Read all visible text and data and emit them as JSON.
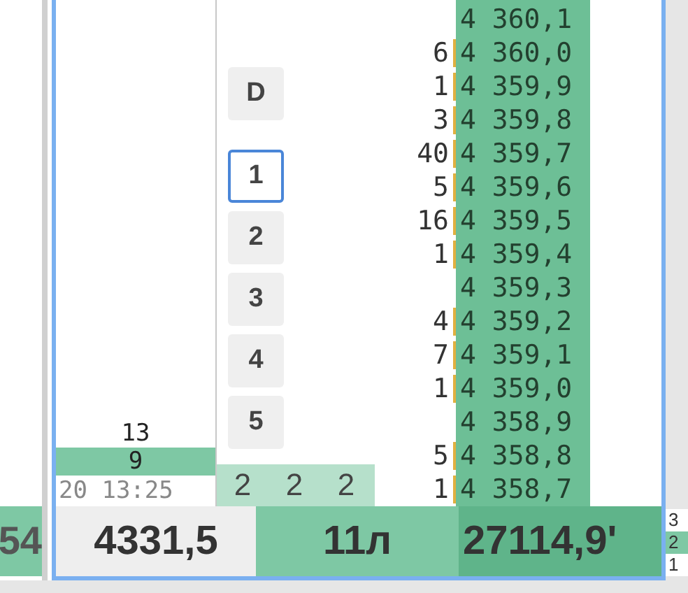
{
  "left_panel": {
    "bottom_value": "54"
  },
  "trades": {
    "rows": [
      {
        "text": "13",
        "highlighted": false
      },
      {
        "text": "9",
        "highlighted": true
      }
    ],
    "time": "20 13:25"
  },
  "scale_buttons": [
    {
      "label": "D",
      "selected": false
    },
    {
      "label": "1",
      "selected": true
    },
    {
      "label": "2",
      "selected": false
    },
    {
      "label": "3",
      "selected": false
    },
    {
      "label": "4",
      "selected": false
    },
    {
      "label": "5",
      "selected": false
    }
  ],
  "counters": [
    "2",
    "2",
    "2"
  ],
  "order_book": [
    {
      "price": "4 360,1"
    },
    {
      "price": "4 360,0",
      "volume": "6"
    },
    {
      "price": "4 359,9",
      "volume": "1"
    },
    {
      "price": "4 359,8",
      "volume": "3"
    },
    {
      "price": "4 359,7",
      "volume": "40"
    },
    {
      "price": "4 359,6",
      "volume": "5"
    },
    {
      "price": "4 359,5",
      "volume": "16"
    },
    {
      "price": "4 359,4",
      "volume": "1"
    },
    {
      "price": "4 359,3"
    },
    {
      "price": "4 359,2",
      "volume": "4"
    },
    {
      "price": "4 359,1",
      "volume": "7"
    },
    {
      "price": "4 359,0",
      "volume": "1"
    },
    {
      "price": "4 358,9"
    },
    {
      "price": "4 358,8",
      "volume": "5"
    },
    {
      "price": "4 358,7",
      "volume": "1"
    }
  ],
  "footer": {
    "last_price": "4331,5",
    "position": "11л",
    "amount": "27114,9'"
  },
  "right_panel": {
    "fragments": [
      "3",
      "2",
      "1"
    ]
  }
}
